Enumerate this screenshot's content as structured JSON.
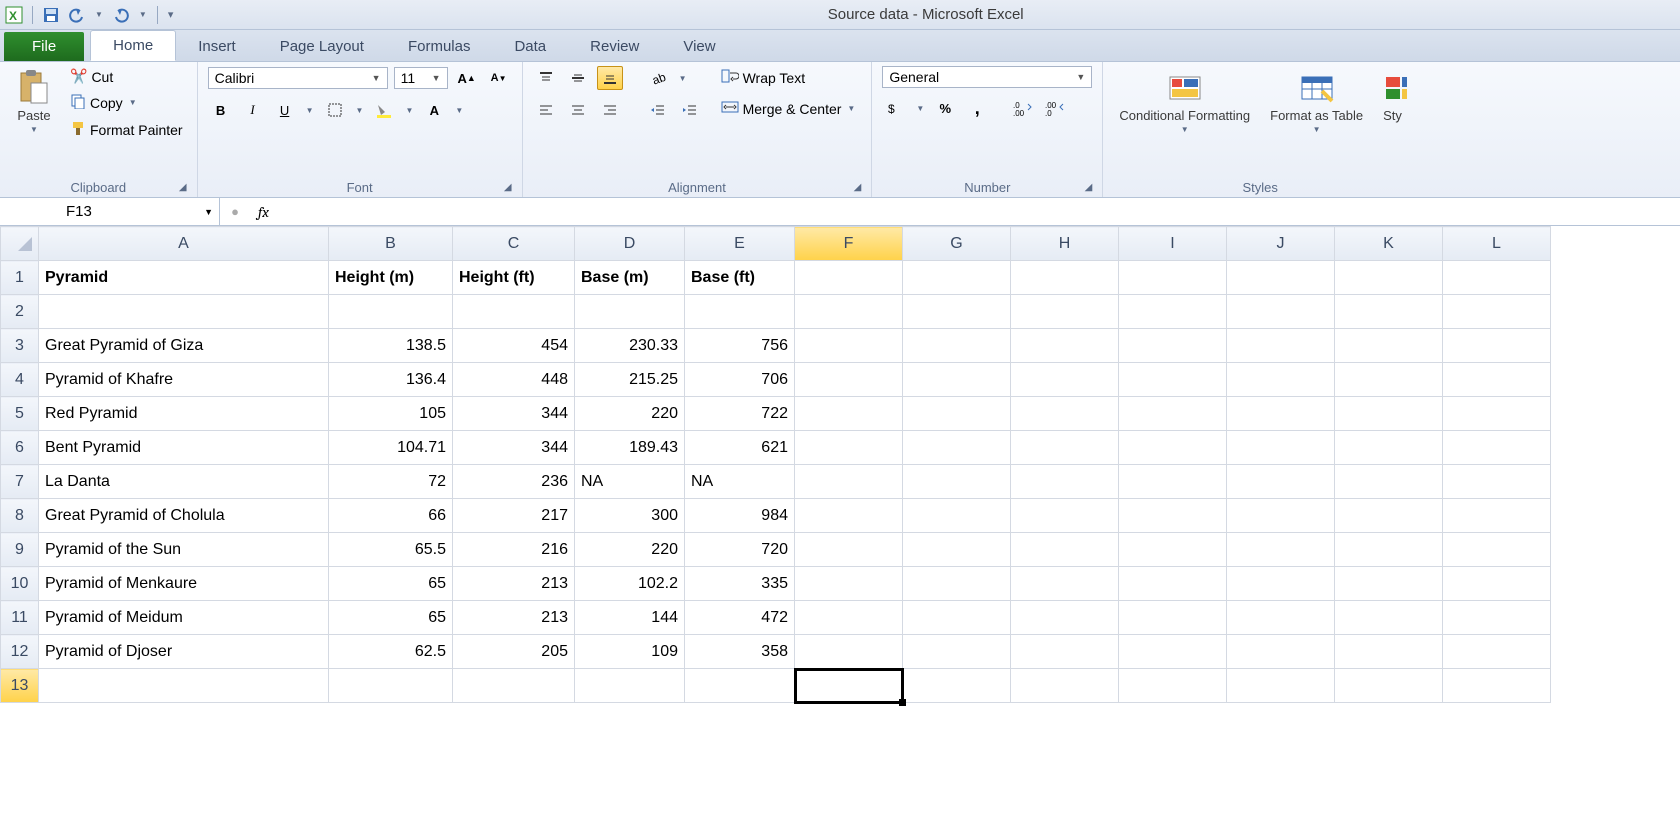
{
  "app": {
    "title": "Source data  -  Microsoft Excel"
  },
  "tabs": {
    "file": "File",
    "home": "Home",
    "insert": "Insert",
    "page_layout": "Page Layout",
    "formulas": "Formulas",
    "data": "Data",
    "review": "Review",
    "view": "View"
  },
  "ribbon": {
    "clipboard": {
      "label": "Clipboard",
      "paste": "Paste",
      "cut": "Cut",
      "copy": "Copy",
      "format_painter": "Format Painter"
    },
    "font": {
      "label": "Font",
      "family": "Calibri",
      "size": "11"
    },
    "alignment": {
      "label": "Alignment",
      "wrap": "Wrap Text",
      "merge": "Merge & Center"
    },
    "number": {
      "label": "Number",
      "format": "General"
    },
    "styles": {
      "label": "Styles",
      "conditional": "Conditional Formatting",
      "as_table": "Format as Table",
      "cell_styles": "Sty"
    }
  },
  "formula_bar": {
    "cell_ref": "F13",
    "fx": "fx",
    "value": ""
  },
  "columns": [
    "A",
    "B",
    "C",
    "D",
    "E",
    "F",
    "G",
    "H",
    "I",
    "J",
    "K",
    "L"
  ],
  "headers": {
    "A": "Pyramid",
    "B": "Height (m)",
    "C": "Height (ft)",
    "D": "Base (m)",
    "E": "Base (ft)"
  },
  "rows": [
    {
      "n": 1,
      "A": "Pyramid",
      "B": "Height (m)",
      "C": "Height (ft)",
      "D": "Base (m)",
      "E": "Base (ft)",
      "bold": true,
      "align": {
        "A": "l",
        "B": "l",
        "C": "l",
        "D": "l",
        "E": "l"
      }
    },
    {
      "n": 2
    },
    {
      "n": 3,
      "A": "Great Pyramid of Giza",
      "B": "138.5",
      "C": "454",
      "D": "230.33",
      "E": "756"
    },
    {
      "n": 4,
      "A": "Pyramid of Khafre",
      "B": "136.4",
      "C": "448",
      "D": "215.25",
      "E": "706"
    },
    {
      "n": 5,
      "A": "Red Pyramid",
      "B": "105",
      "C": "344",
      "D": "220",
      "E": "722"
    },
    {
      "n": 6,
      "A": "Bent Pyramid",
      "B": "104.71",
      "C": "344",
      "D": "189.43",
      "E": "621"
    },
    {
      "n": 7,
      "A": "La Danta",
      "B": "72",
      "C": "236",
      "D": "NA",
      "E": "NA",
      "align": {
        "D": "l",
        "E": "l"
      }
    },
    {
      "n": 8,
      "A": "Great Pyramid of Cholula",
      "B": "66",
      "C": "217",
      "D": "300",
      "E": "984"
    },
    {
      "n": 9,
      "A": "Pyramid of the Sun",
      "B": "65.5",
      "C": "216",
      "D": "220",
      "E": "720"
    },
    {
      "n": 10,
      "A": "Pyramid of Menkaure",
      "B": "65",
      "C": "213",
      "D": "102.2",
      "E": "335"
    },
    {
      "n": 11,
      "A": "Pyramid of Meidum",
      "B": "65",
      "C": "213",
      "D": "144",
      "E": "472"
    },
    {
      "n": 12,
      "A": "Pyramid of Djoser",
      "B": "62.5",
      "C": "205",
      "D": "109",
      "E": "358"
    },
    {
      "n": 13
    }
  ],
  "active_cell": {
    "row": 13,
    "col": "F"
  },
  "chart_data": {
    "type": "table",
    "columns": [
      "Pyramid",
      "Height (m)",
      "Height (ft)",
      "Base (m)",
      "Base (ft)"
    ],
    "rows": [
      [
        "Great Pyramid of Giza",
        138.5,
        454,
        230.33,
        756
      ],
      [
        "Pyramid of Khafre",
        136.4,
        448,
        215.25,
        706
      ],
      [
        "Red Pyramid",
        105,
        344,
        220,
        722
      ],
      [
        "Bent Pyramid",
        104.71,
        344,
        189.43,
        621
      ],
      [
        "La Danta",
        72,
        236,
        "NA",
        "NA"
      ],
      [
        "Great Pyramid of Cholula",
        66,
        217,
        300,
        984
      ],
      [
        "Pyramid of the Sun",
        65.5,
        216,
        220,
        720
      ],
      [
        "Pyramid of Menkaure",
        65,
        213,
        102.2,
        335
      ],
      [
        "Pyramid of Meidum",
        65,
        213,
        144,
        472
      ],
      [
        "Pyramid of Djoser",
        62.5,
        205,
        109,
        358
      ]
    ]
  }
}
